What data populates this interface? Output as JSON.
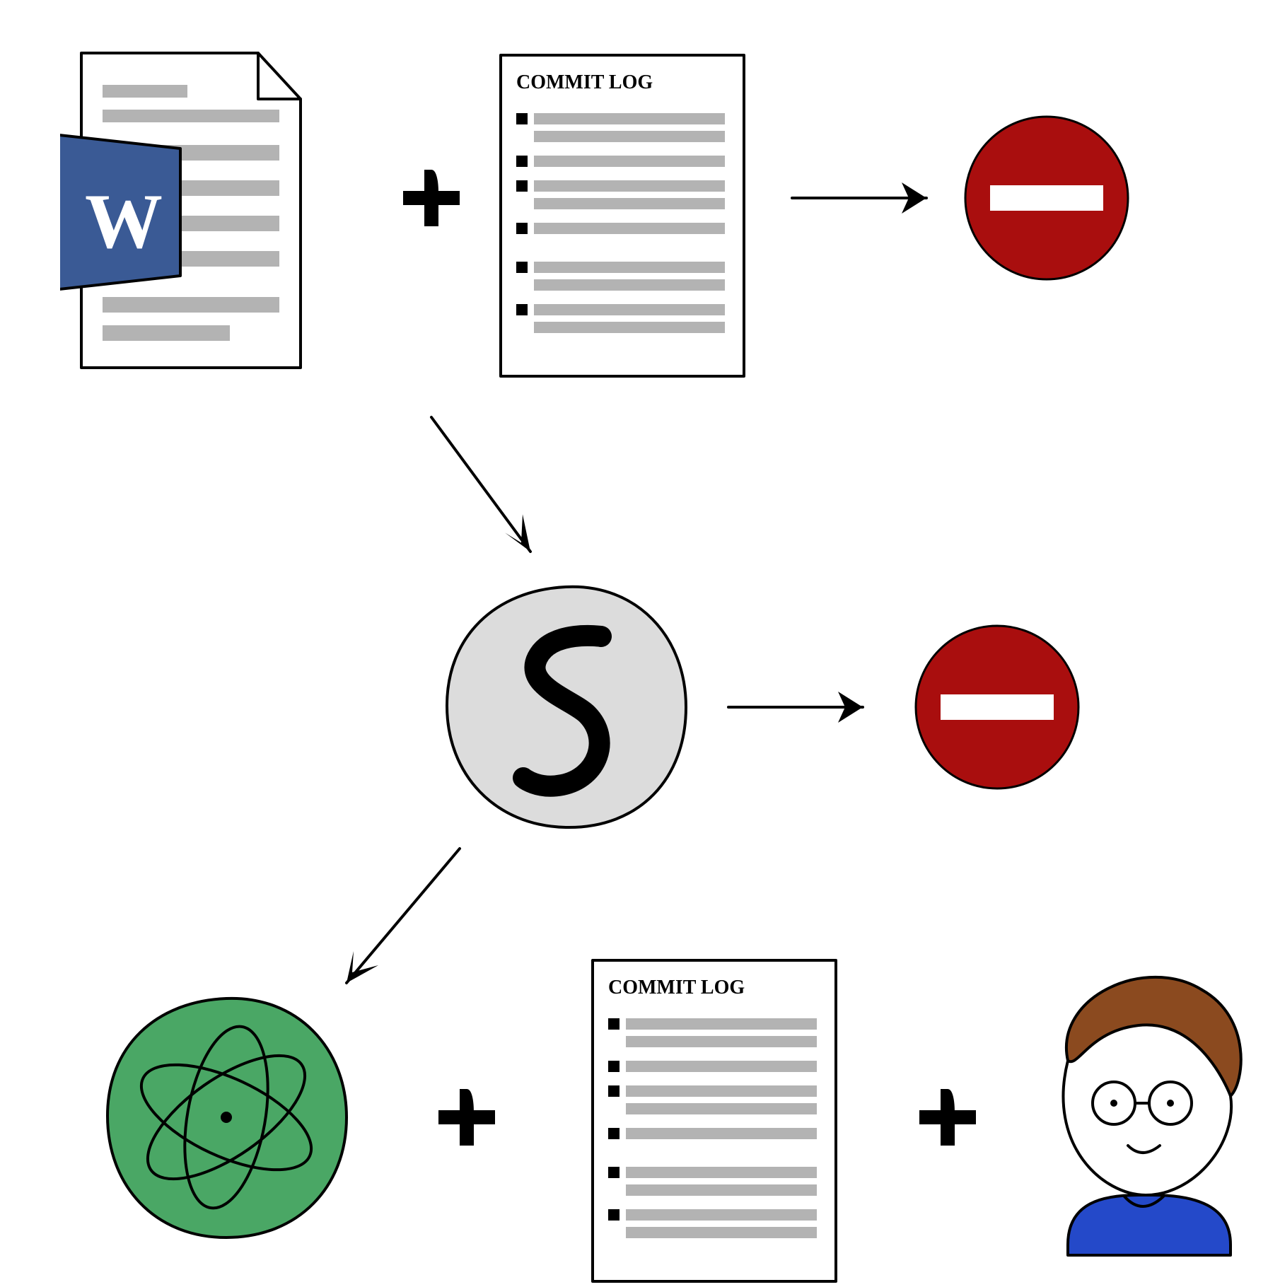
{
  "diagram": {
    "row1": {
      "word_doc": {
        "letter": "W"
      },
      "commit_log": {
        "title": "COMMIT LOG",
        "entries": 6
      },
      "plus": "+",
      "outcome": "no-entry"
    },
    "row2": {
      "s_circle": {
        "letter": "S"
      },
      "outcome": "no-entry"
    },
    "row3": {
      "atom_circle": {
        "label": "atom"
      },
      "plus1": "+",
      "commit_log": {
        "title": "COMMIT LOG",
        "entries": 6
      },
      "plus2": "+",
      "person": {
        "label": "person"
      }
    },
    "arrows": {
      "r1_to_noentry": true,
      "r1_to_s": true,
      "s_to_noentry": true,
      "s_to_atom": true
    }
  }
}
